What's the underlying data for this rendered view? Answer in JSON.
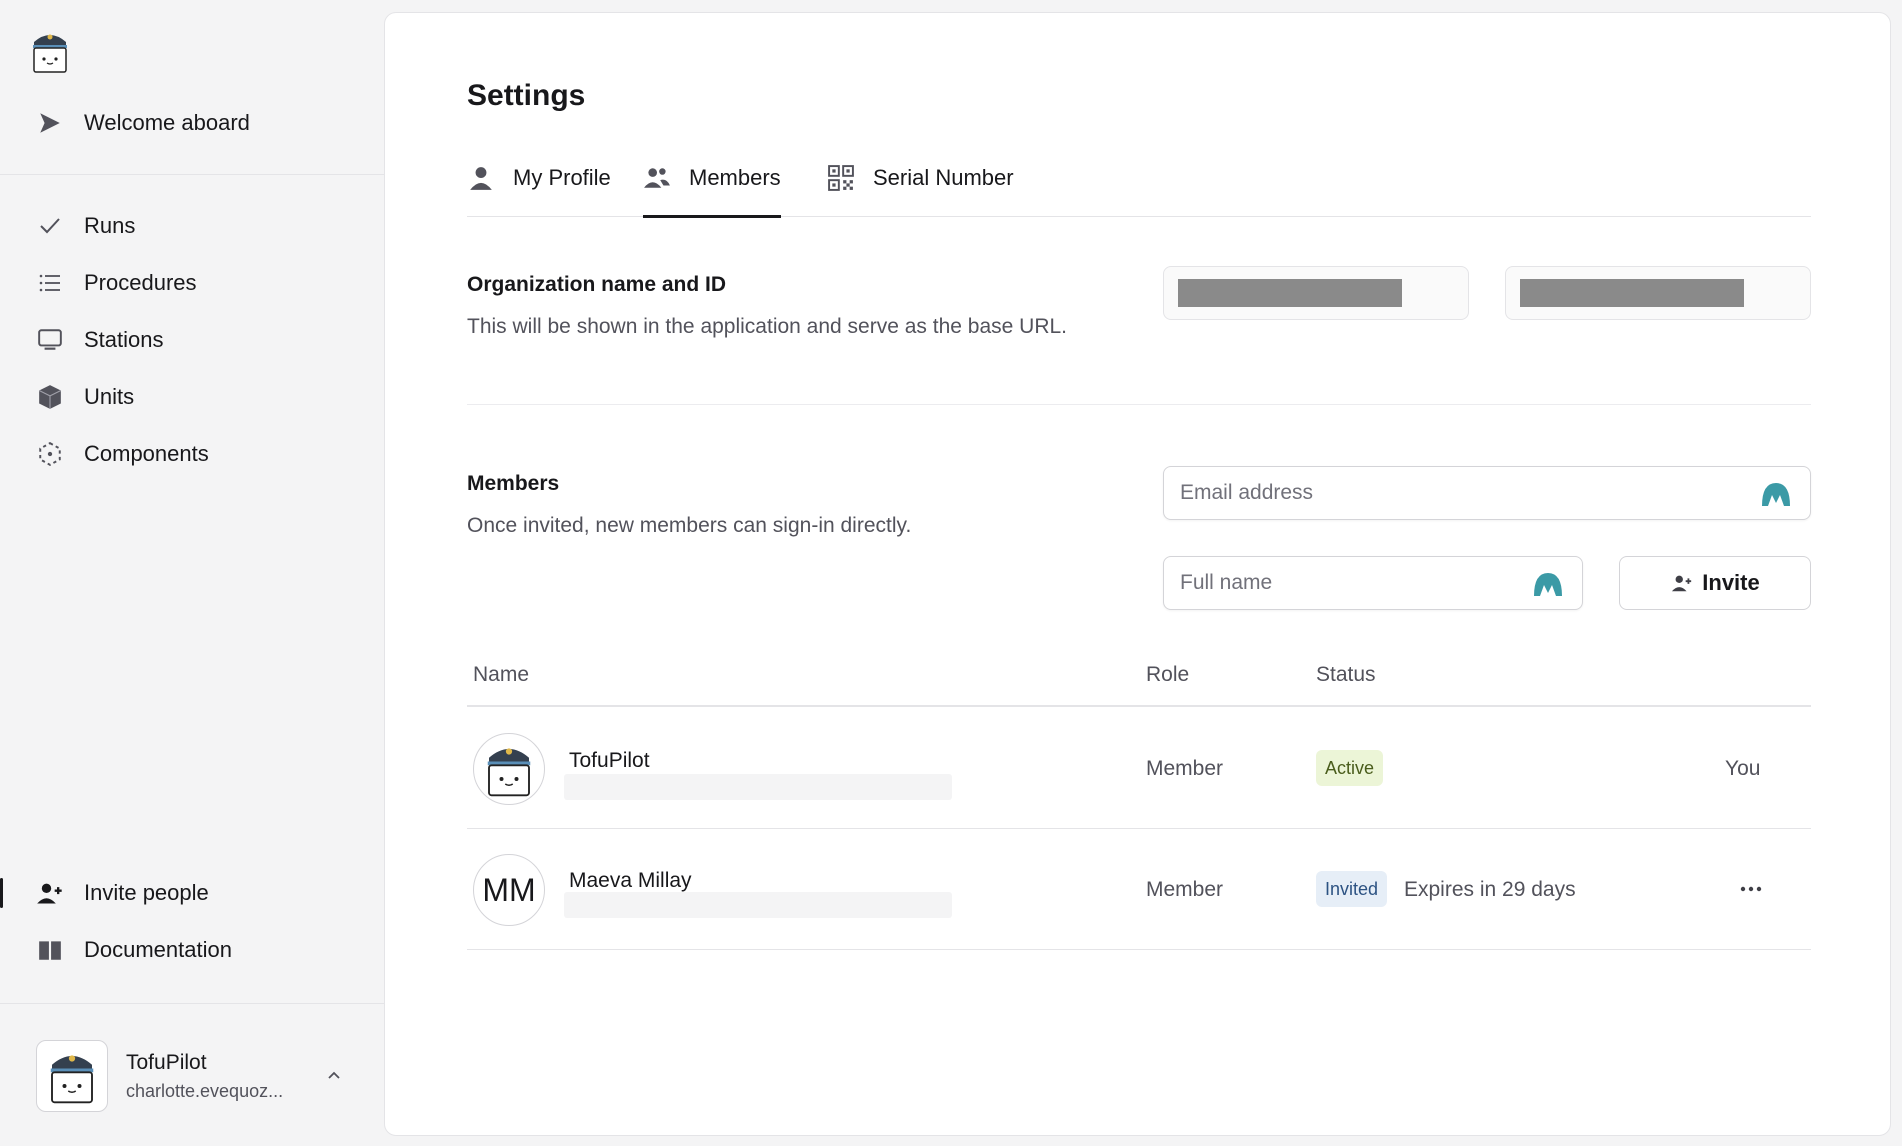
{
  "sidebar": {
    "welcome": "Welcome aboard",
    "nav": [
      {
        "label": "Runs",
        "icon": "check-icon"
      },
      {
        "label": "Procedures",
        "icon": "list-icon"
      },
      {
        "label": "Stations",
        "icon": "monitor-icon"
      },
      {
        "label": "Units",
        "icon": "cube-icon"
      },
      {
        "label": "Components",
        "icon": "component-icon"
      }
    ],
    "bottom": [
      {
        "label": "Invite people",
        "icon": "user-plus-icon"
      },
      {
        "label": "Documentation",
        "icon": "book-icon"
      }
    ],
    "user": {
      "name": "TofuPilot",
      "email": "charlotte.evequoz..."
    }
  },
  "main": {
    "title": "Settings",
    "tabs": [
      {
        "label": "My Profile",
        "icon": "user-icon"
      },
      {
        "label": "Members",
        "icon": "users-icon",
        "active": true
      },
      {
        "label": "Serial Number",
        "icon": "qr-code-icon"
      }
    ],
    "org": {
      "title": "Organization name and ID",
      "description": "This will be shown in the application and serve as the base URL."
    },
    "members": {
      "title": "Members",
      "description": "Once invited, new members can sign-in directly.",
      "email_placeholder": "Email address",
      "name_placeholder": "Full name",
      "invite_label": "Invite"
    },
    "table": {
      "columns": [
        "Name",
        "Role",
        "Status"
      ],
      "rows": [
        {
          "name": "TofuPilot",
          "role": "Member",
          "status": "Active",
          "note": "You"
        },
        {
          "name": "Maeva Millay",
          "initials": "MM",
          "role": "Member",
          "status": "Invited",
          "note": "Expires in 29 days"
        }
      ]
    }
  },
  "colors": {
    "accent": "#18181b",
    "active_badge_bg": "#ecf5d7",
    "invited_badge_bg": "#e6eef7",
    "password_manager": "#3b9aa6"
  }
}
